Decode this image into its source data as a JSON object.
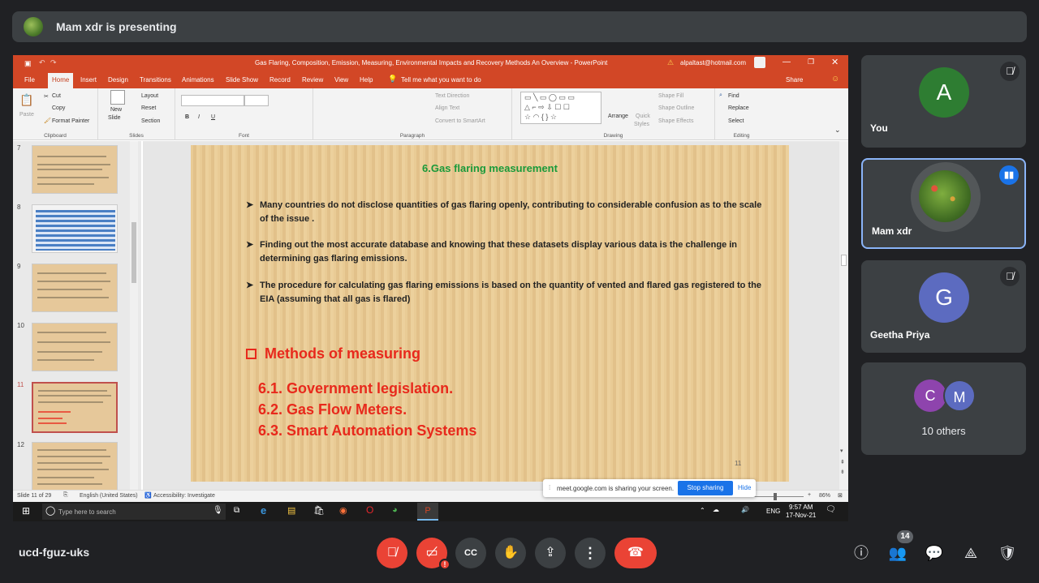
{
  "meet": {
    "presenting": "Mam xdr is presenting",
    "meeting_code": "ucd-fguz-uks",
    "people_count": "14"
  },
  "ppt": {
    "title": "Gas Flaring, Composition, Emission, Measuring, Environmental Impacts and Recovery Methods An Overview  -  PowerPoint",
    "account": "alpaltast@hotmail.com",
    "tabs": [
      "File",
      "Home",
      "Insert",
      "Design",
      "Transitions",
      "Animations",
      "Slide Show",
      "Record",
      "Review",
      "View",
      "Help"
    ],
    "tell_me": "Tell me what you want to do",
    "share": "Share",
    "ribbon": {
      "clipboard": {
        "paste": "Paste",
        "cut": "Cut",
        "copy": "Copy",
        "format_painter": "Format Painter",
        "label": "Clipboard"
      },
      "slides": {
        "new_slide": "New",
        "new_slide2": "Slide",
        "layout": "Layout",
        "reset": "Reset",
        "section": "Section",
        "label": "Slides"
      },
      "font": {
        "label": "Font"
      },
      "paragraph": {
        "text_direction": "Text Direction",
        "align_text": "Align Text",
        "convert": "Convert to SmartArt",
        "label": "Paragraph"
      },
      "drawing": {
        "arrange": "Arrange",
        "quick": "Quick",
        "styles": "Styles",
        "shape_fill": "Shape Fill",
        "shape_outline": "Shape Outline",
        "shape_effects": "Shape Effects",
        "label": "Drawing"
      },
      "editing": {
        "find": "Find",
        "replace": "Replace",
        "select": "Select",
        "label": "Editing"
      }
    },
    "thumb_numbers": [
      "7",
      "8",
      "9",
      "10",
      "11",
      "12"
    ],
    "slide": {
      "title": "6.Gas flaring measurement",
      "bullets": [
        "Many countries do not disclose quantities of gas flaring openly, contributing to considerable confusion as to the scale of the issue .",
        "Finding out the most accurate database and knowing that these datasets display various data is the challenge in determining gas flaring emissions.",
        " The procedure for calculating gas flaring emissions is based on the quantity of vented and flared gas registered to the EIA (assuming that all gas is flared)"
      ],
      "methods_heading": "Methods of measuring",
      "methods": [
        "6.1. Government legislation.",
        "6.2. Gas Flow Meters.",
        "6.3. Smart Automation Systems"
      ],
      "page_number": "11"
    },
    "status": {
      "slide": "Slide 11 of 29",
      "language": "English (United States)",
      "accessibility": "Accessibility: Investigate",
      "zoom": "86%"
    },
    "taskbar": {
      "search": "Type here to search",
      "lang": "ENG",
      "time": "9:57 AM",
      "date": "17-Nov-21"
    }
  },
  "share_notice": {
    "text": "meet.google.com is sharing your screen.",
    "stop": "Stop sharing",
    "hide": "Hide"
  },
  "participants": [
    {
      "name": "You",
      "initial": "A",
      "color": "#2e7d32"
    },
    {
      "name": "Mam xdr"
    },
    {
      "name": "Geetha Priya",
      "initial": "G",
      "color": "#5c6bc0"
    },
    {
      "name": "10 others",
      "initials": [
        "C",
        "M"
      ],
      "colors": [
        "#8e44ad",
        "#5c6bc0"
      ]
    }
  ],
  "icons": {
    "mic_off": "mic-off-icon",
    "camera_off": "camera-off-icon",
    "captions": "captions-icon",
    "hand": "raise-hand-icon",
    "present": "present-icon",
    "more": "more-icon",
    "hangup": "hangup-icon",
    "info": "info-icon",
    "people": "people-icon",
    "chat": "chat-icon",
    "activities": "activities-icon",
    "lock": "host-controls-icon"
  }
}
